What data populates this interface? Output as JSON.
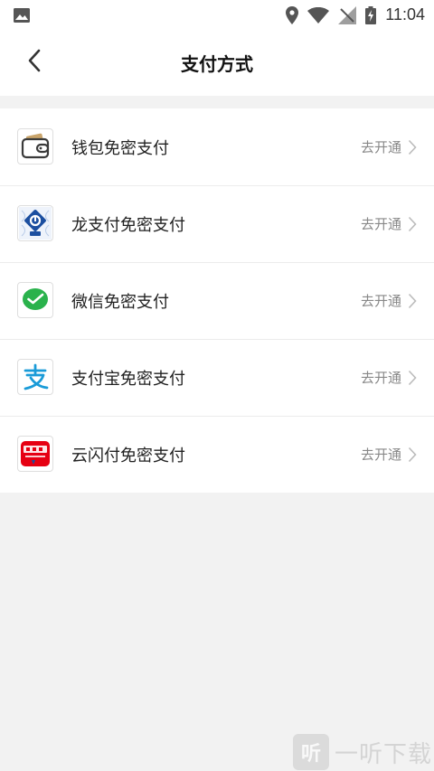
{
  "status_bar": {
    "time": "11:04",
    "icons": [
      "image-icon",
      "location-icon",
      "wifi-icon",
      "signal-off-icon",
      "battery-charging-icon"
    ]
  },
  "header": {
    "title": "支付方式",
    "back_icon": "chevron-left-icon"
  },
  "payment_methods": [
    {
      "label": "钱包免密支付",
      "action": "去开通",
      "icon": "wallet-icon"
    },
    {
      "label": "龙支付免密支付",
      "action": "去开通",
      "icon": "ccb-longpay-icon"
    },
    {
      "label": "微信免密支付",
      "action": "去开通",
      "icon": "wechat-pay-icon"
    },
    {
      "label": "支付宝免密支付",
      "action": "去开通",
      "icon": "alipay-icon"
    },
    {
      "label": "云闪付免密支付",
      "action": "去开通",
      "icon": "unionpay-quickpass-icon"
    }
  ],
  "watermark": {
    "logo_char": "听",
    "text": "一听下载"
  },
  "colors": {
    "background": "#f2f2f2",
    "surface": "#ffffff",
    "wechat_green": "#2ab24c",
    "alipay_blue": "#1a9bd8",
    "ccb_blue": "#1c4fa0",
    "unionpay_red": "#e60012",
    "wallet_tan": "#c9a46b"
  }
}
